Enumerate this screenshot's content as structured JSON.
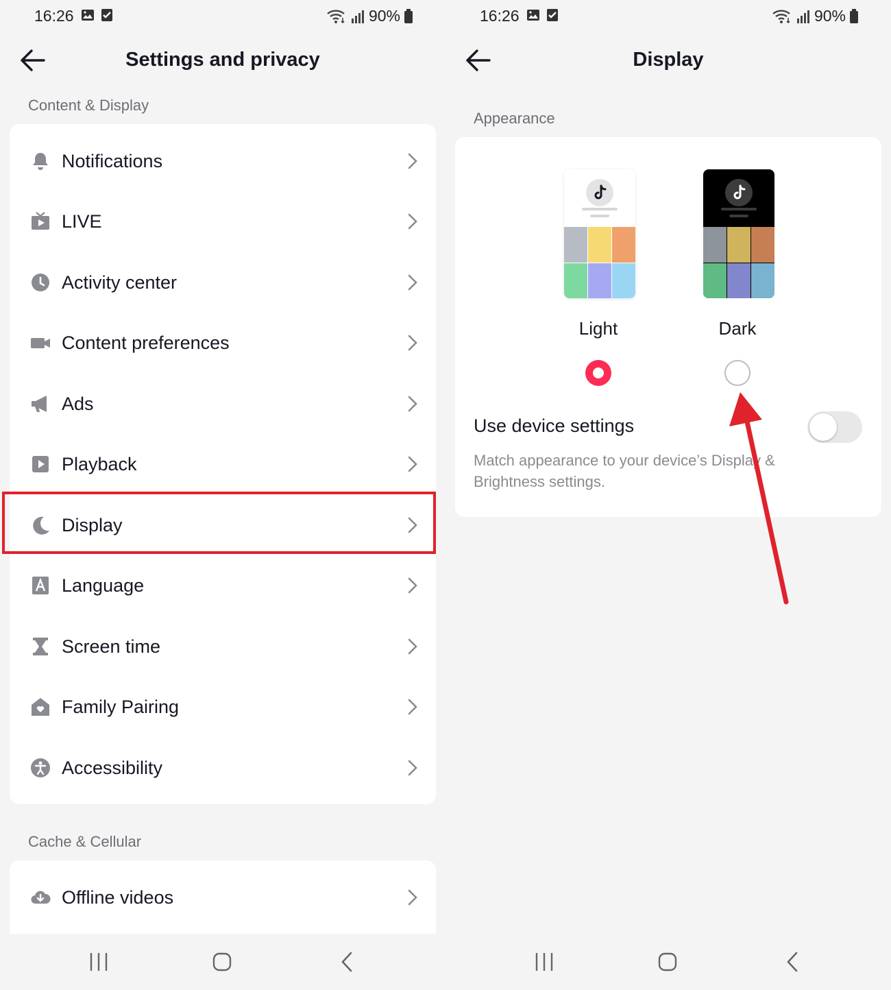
{
  "status_bar": {
    "time": "16:26",
    "battery": "90%"
  },
  "left_screen": {
    "title": "Settings and privacy",
    "section1": "Content & Display",
    "items": [
      {
        "label": "Notifications",
        "icon": "bell-icon"
      },
      {
        "label": "LIVE",
        "icon": "tv-icon"
      },
      {
        "label": "Activity center",
        "icon": "clock-icon"
      },
      {
        "label": "Content preferences",
        "icon": "video-camera-icon"
      },
      {
        "label": "Ads",
        "icon": "megaphone-icon"
      },
      {
        "label": "Playback",
        "icon": "play-icon"
      },
      {
        "label": "Display",
        "icon": "moon-icon"
      },
      {
        "label": "Language",
        "icon": "language-icon"
      },
      {
        "label": "Screen time",
        "icon": "hourglass-icon"
      },
      {
        "label": "Family Pairing",
        "icon": "home-heart-icon"
      },
      {
        "label": "Accessibility",
        "icon": "accessibility-icon"
      }
    ],
    "section2": "Cache & Cellular",
    "items2": [
      {
        "label": "Offline videos",
        "icon": "cloud-download-icon"
      }
    ],
    "highlighted_item": "Display"
  },
  "right_screen": {
    "title": "Display",
    "section": "Appearance",
    "themes": [
      {
        "label": "Light",
        "selected": true
      },
      {
        "label": "Dark",
        "selected": false
      }
    ],
    "device_settings_title": "Use device settings",
    "device_settings_desc": "Match appearance to your device’s Display & Brightness settings.",
    "device_settings_on": false
  },
  "colors": {
    "accent": "#fe2c55",
    "annotation": "#e0222d",
    "background": "#f4f4f4",
    "card": "#ffffff",
    "icon_gray": "#8a8b91"
  }
}
